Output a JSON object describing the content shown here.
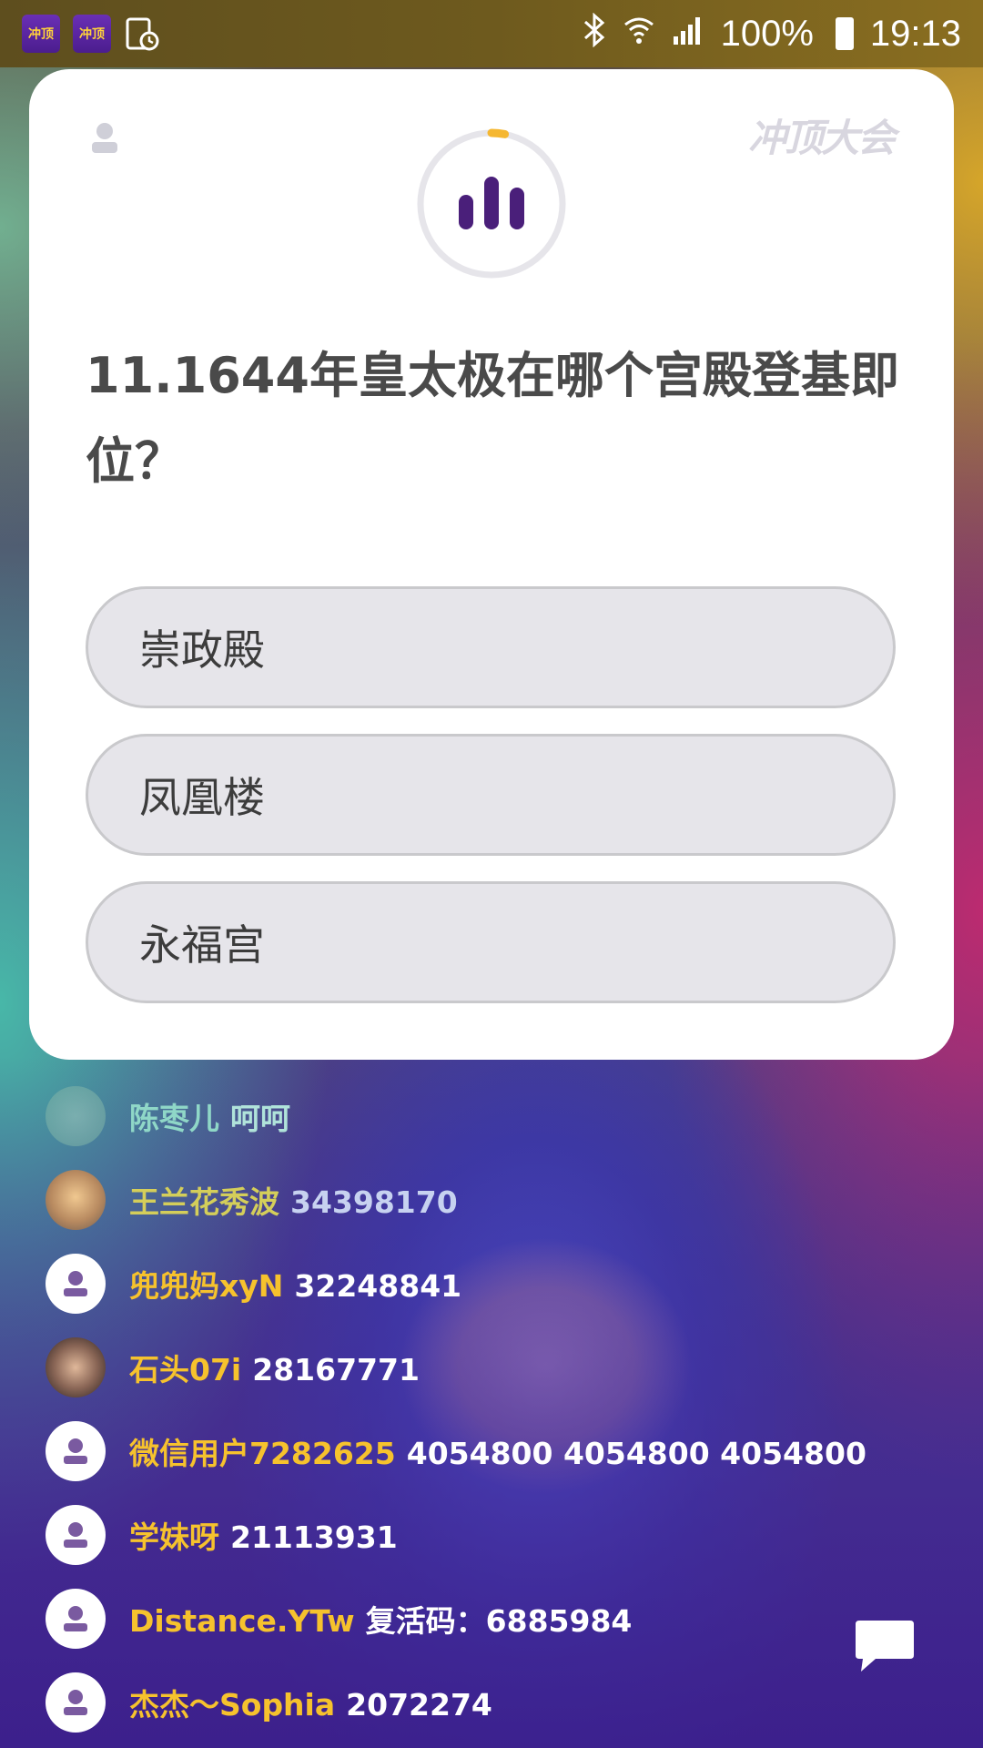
{
  "status_bar": {
    "time": "19:13",
    "battery": "100%",
    "app_icon_text": "冲顶"
  },
  "brand": {
    "logo_text": "冲顶大会"
  },
  "question": {
    "text": "11.1644年皇太极在哪个宫殿登基即位？",
    "progress_fraction": 0.03,
    "options": [
      "崇政殿",
      "凤凰楼",
      "永福宫"
    ]
  },
  "comments": [
    {
      "name": "陈枣儿",
      "message": "呵呵",
      "avatar": "photo0",
      "style": "faded"
    },
    {
      "name": "王兰花秀波",
      "message": "34398170",
      "avatar": "photo1",
      "style": "semi"
    },
    {
      "name": "兜兜妈xyN",
      "message": "32248841",
      "avatar": "default",
      "style": "normal"
    },
    {
      "name": "石头07i",
      "message": "28167771",
      "avatar": "photo2",
      "style": "normal"
    },
    {
      "name": "微信用户7282625",
      "message": "4054800 4054800 4054800",
      "avatar": "default",
      "style": "normal"
    },
    {
      "name": "学妹呀",
      "message": "21113931",
      "avatar": "default",
      "style": "normal"
    },
    {
      "name": "Distance.YTw",
      "message": "复活码：6885984",
      "avatar": "default",
      "style": "normal"
    },
    {
      "name": "杰杰～Sophia",
      "message": "2072274",
      "avatar": "default",
      "style": "normal"
    }
  ],
  "colors": {
    "accent_timer": "#f5b731",
    "bars": "#4a1f7a",
    "comment_name": "#f6c22d"
  }
}
